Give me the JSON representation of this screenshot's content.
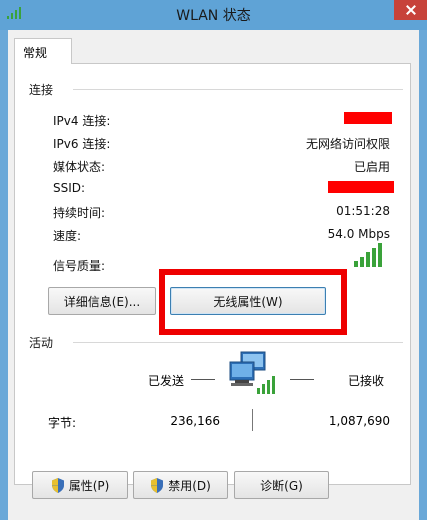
{
  "window": {
    "title": "WLAN 状态"
  },
  "tab": {
    "label": "常规"
  },
  "connection": {
    "section_label": "连接",
    "rows": [
      {
        "label": "IPv4 连接:",
        "value": ""
      },
      {
        "label": "IPv6 连接:",
        "value": "无网络访问权限"
      },
      {
        "label": "媒体状态:",
        "value": "已启用"
      },
      {
        "label": "SSID:",
        "value": ""
      },
      {
        "label": "持续时间:",
        "value": "01:51:28"
      },
      {
        "label": "速度:",
        "value": "54.0 Mbps"
      },
      {
        "label": "信号质量:",
        "value": ""
      }
    ],
    "signal_bars": 5,
    "details_button": "详细信息(E)...",
    "wireless_props_button": "无线属性(W)"
  },
  "activity": {
    "section_label": "活动",
    "sent_label": "已发送",
    "received_label": "已接收",
    "bytes_label": "字节:",
    "bytes_sent": "236,166",
    "bytes_received": "1,087,690"
  },
  "footer": {
    "properties_button": "属性(P)",
    "disable_button": "禁用(D)",
    "diagnose_button": "诊断(G)"
  },
  "colors": {
    "title_bar": "#5fa3d6",
    "close_button": "#c7423a",
    "redaction": "#ff0000",
    "signal_green": "#3aa23a"
  }
}
